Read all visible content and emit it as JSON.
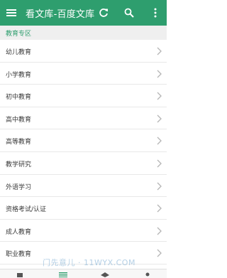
{
  "appbar": {
    "title": "看文库-百度文库",
    "icons": [
      "menu-icon",
      "refresh-icon",
      "search-icon",
      "more-vert-icon"
    ],
    "color": "#2e9e6e"
  },
  "section": {
    "header": "教育专区"
  },
  "items": [
    {
      "label": "幼儿教育"
    },
    {
      "label": "小学教育"
    },
    {
      "label": "初中教育"
    },
    {
      "label": "高中教育"
    },
    {
      "label": "高等教育"
    },
    {
      "label": "教学研究"
    },
    {
      "label": "外语学习"
    },
    {
      "label": "资格考试/认证"
    },
    {
      "label": "成人教育"
    },
    {
      "label": "职业教育"
    }
  ],
  "bottom_nav": {
    "icons": [
      "book-icon",
      "list-icon",
      "layers-icon",
      "person-icon"
    ]
  },
  "watermark": "门先意儿 · 11WYX.COM"
}
